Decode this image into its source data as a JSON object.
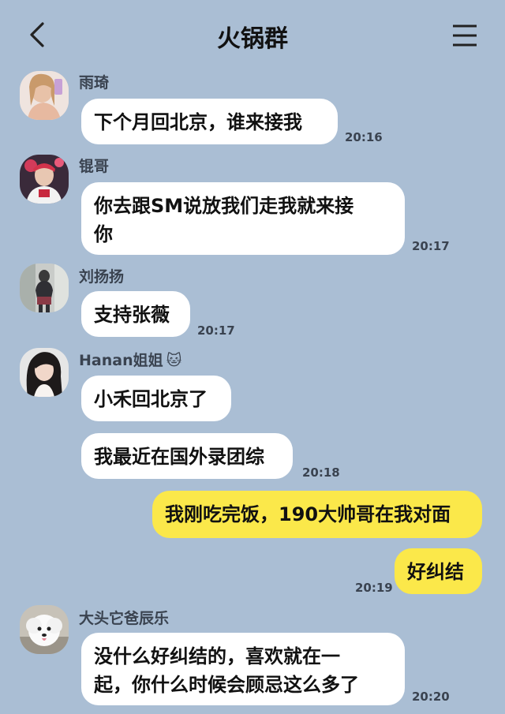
{
  "header": {
    "title": "火锅群"
  },
  "messages": [
    {
      "sender": "雨琦",
      "text": "下个月回北京，谁来接我",
      "time": "20:16"
    },
    {
      "sender": "锟哥",
      "text_line1": "你去跟SM说放我们走我就来接",
      "text_line2": "你",
      "time": "20:17"
    },
    {
      "sender": "刘扬扬",
      "text": "支持张薇",
      "time": "20:17"
    },
    {
      "sender": "Hanan姐姐",
      "sender_emoji": "🐱",
      "text1": "小禾回北京了",
      "text2": "我最近在国外录团综",
      "time": "20:18"
    },
    {
      "sender": "self",
      "text1": "我刚吃完饭，190大帅哥在我对面",
      "text2": "好纠结",
      "time": "20:19"
    },
    {
      "sender": "大头它爸辰乐",
      "text_line1": "没什么好纠结的，喜欢就在一",
      "text_line2": "起，你什么时候会顾忌这么多了",
      "time": "20:20"
    }
  ],
  "icons": {
    "back": "chevron-left-icon",
    "menu": "hamburger-menu-icon"
  }
}
